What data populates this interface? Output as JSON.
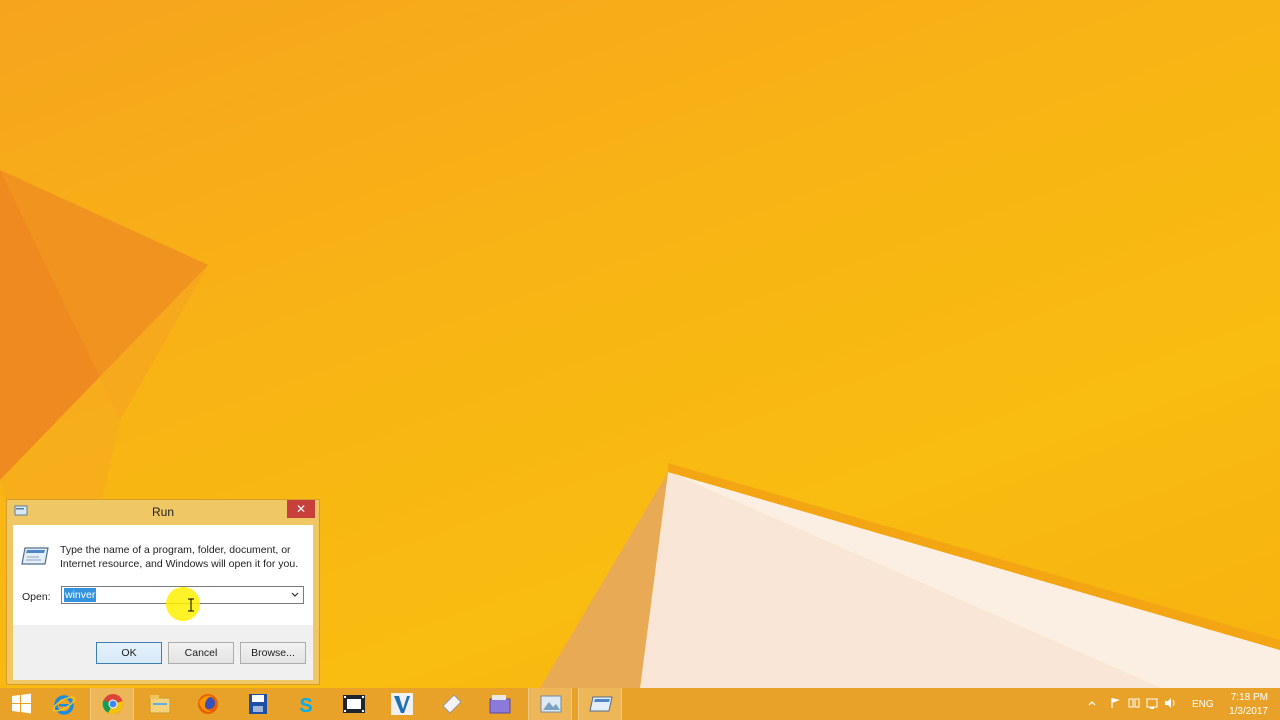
{
  "colors": {
    "accent": "#e8a22a",
    "close_button": "#c7403b",
    "selection": "#3393df"
  },
  "run_dialog": {
    "title": "Run",
    "description": "Type the name of a program, folder, document, or Internet resource, and Windows will open it for you.",
    "open_label": "Open:",
    "open_value": "winver",
    "ok_label": "OK",
    "cancel_label": "Cancel",
    "browse_label": "Browse...",
    "close_symbol": "✕"
  },
  "taskbar": {
    "items": [
      {
        "icon": "start-icon"
      },
      {
        "icon": "internet-explorer-icon"
      },
      {
        "icon": "chrome-icon"
      },
      {
        "icon": "file-explorer-icon"
      },
      {
        "icon": "firefox-icon"
      },
      {
        "icon": "save-disk-icon"
      },
      {
        "icon": "skype-icon"
      },
      {
        "icon": "video-editor-icon"
      },
      {
        "icon": "visual-studio-icon"
      },
      {
        "icon": "eraser-icon"
      },
      {
        "icon": "folder-window-icon"
      },
      {
        "icon": "image-app-icon"
      },
      {
        "icon": "run-icon"
      }
    ],
    "tray": {
      "language": "ENG",
      "time": "7:18 PM",
      "date": "1/3/2017"
    }
  }
}
